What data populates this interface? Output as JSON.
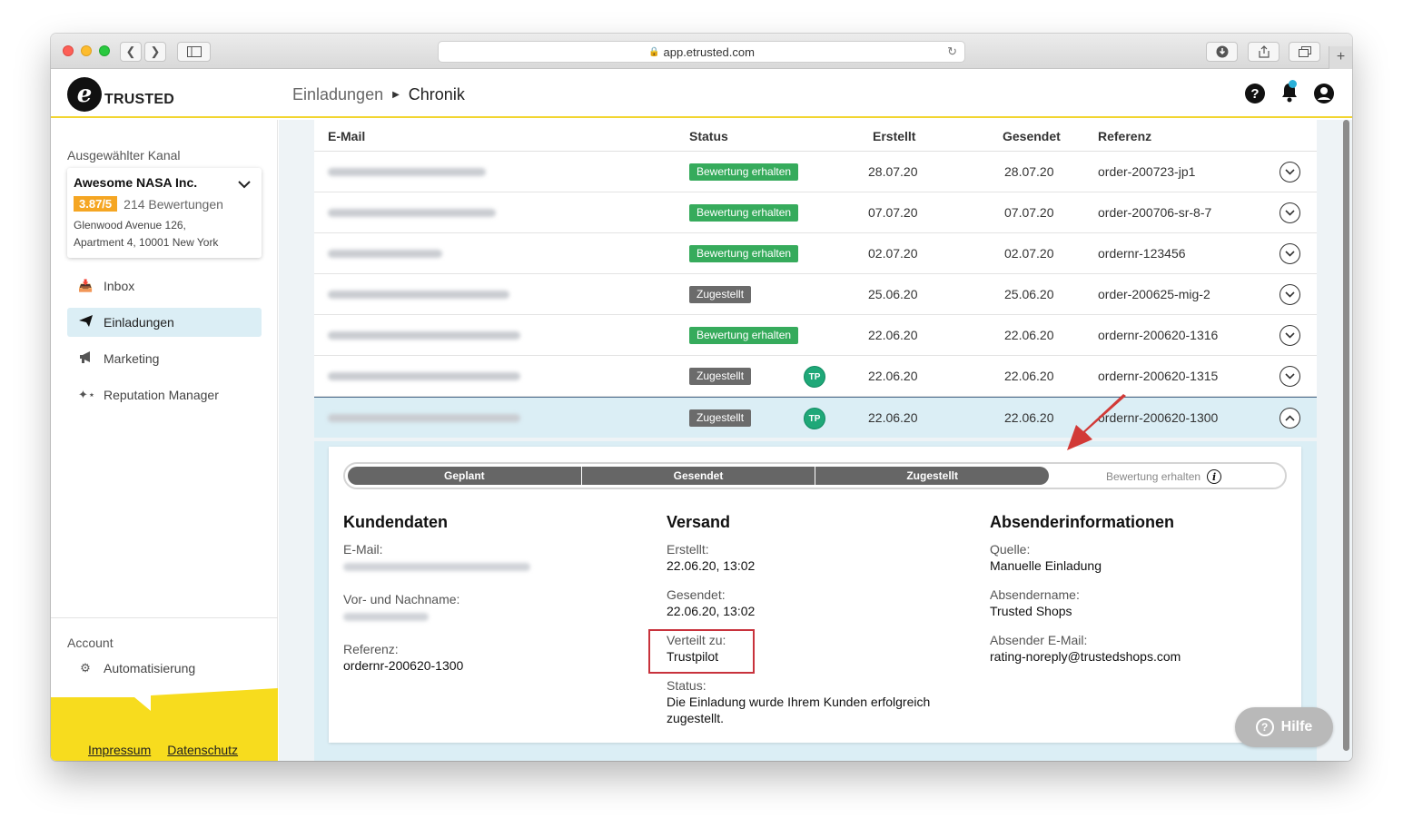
{
  "browser": {
    "url": "app.etrusted.com",
    "new_tab": "+"
  },
  "header": {
    "logo_letter": "e",
    "logo_text": "TRUSTED",
    "breadcrumb": [
      "Einladungen",
      "Chronik"
    ],
    "help_icon": "?"
  },
  "sidebar": {
    "selected_channel_label": "Ausgewählter Kanal",
    "channel": {
      "name": "Awesome NASA Inc.",
      "score": "3.87/5",
      "reviews": "214 Bewertungen",
      "address_line1": "Glenwood Avenue 126,",
      "address_line2": "Apartment 4, 10001 New York"
    },
    "nav": [
      {
        "label": "Inbox",
        "icon": "inbox-icon",
        "active": false
      },
      {
        "label": "Einladungen",
        "icon": "paper-plane-icon",
        "active": true
      },
      {
        "label": "Marketing",
        "icon": "megaphone-icon",
        "active": false
      },
      {
        "label": "Reputation Manager",
        "icon": "stars-icon",
        "active": false
      }
    ],
    "account_label": "Account",
    "automation_label": "Automatisierung",
    "footer_links": [
      "Impressum",
      "Datenschutz"
    ]
  },
  "table": {
    "columns": {
      "email": "E-Mail",
      "status": "Status",
      "created": "Erstellt",
      "sent": "Gesendet",
      "reference": "Referenz"
    },
    "rows": [
      {
        "status": "Bewertung erhalten",
        "status_color": "#36ab5c",
        "tp": "",
        "created": "28.07.20",
        "sent": "28.07.20",
        "reference": "order-200723-jp1"
      },
      {
        "status": "Bewertung erhalten",
        "status_color": "#36ab5c",
        "tp": "",
        "created": "07.07.20",
        "sent": "07.07.20",
        "reference": "order-200706-sr-8-7"
      },
      {
        "status": "Bewertung erhalten",
        "status_color": "#36ab5c",
        "tp": "",
        "created": "02.07.20",
        "sent": "02.07.20",
        "reference": "ordernr-123456"
      },
      {
        "status": "Zugestellt",
        "status_color": "#6b6b6b",
        "tp": "",
        "created": "25.06.20",
        "sent": "25.06.20",
        "reference": "order-200625-mig-2"
      },
      {
        "status": "Bewertung erhalten",
        "status_color": "#36ab5c",
        "tp": "",
        "created": "22.06.20",
        "sent": "22.06.20",
        "reference": "ordernr-200620-1316"
      },
      {
        "status": "Zugestellt",
        "status_color": "#6b6b6b",
        "tp": "TP",
        "created": "22.06.20",
        "sent": "22.06.20",
        "reference": "ordernr-200620-1315"
      },
      {
        "status": "Zugestellt",
        "status_color": "#6b6b6b",
        "tp": "TP",
        "created": "22.06.20",
        "sent": "22.06.20",
        "reference": "ordernr-200620-1300"
      }
    ]
  },
  "detail": {
    "progress_steps": [
      "Geplant",
      "Gesendet",
      "Zugestellt"
    ],
    "progress_pending": "Bewertung erhalten",
    "info_icon": "i",
    "customer": {
      "title": "Kundendaten",
      "email_label": "E-Mail:",
      "name_label": "Vor- und Nachname:",
      "ref_label": "Referenz:",
      "ref_value": "ordernr-200620-1300"
    },
    "shipping": {
      "title": "Versand",
      "created_label": "Erstellt:",
      "created_value": "22.06.20, 13:02",
      "sent_label": "Gesendet:",
      "sent_value": "22.06.20, 13:02",
      "dist_label": "Verteilt zu:",
      "dist_value": "Trustpilot",
      "status_label": "Status:",
      "status_value_1": "Die Einladung wurde Ihrem Kunden erfolgreich",
      "status_value_2": "zugestellt."
    },
    "sender": {
      "title": "Absenderinformationen",
      "source_label": "Quelle:",
      "source_value": "Manuelle Einladung",
      "name_label": "Absendername:",
      "name_value": "Trusted Shops",
      "email_label": "Absender E-Mail:",
      "email_value": "rating-noreply@trustedshops.com"
    }
  },
  "help_button": "Hilfe",
  "colors": {
    "accent_yellow": "#f7dc1e",
    "green": "#36ab5c",
    "gray_badge": "#6b6b6b",
    "tp_green": "#1fa878",
    "highlight_red": "#c8323c"
  }
}
